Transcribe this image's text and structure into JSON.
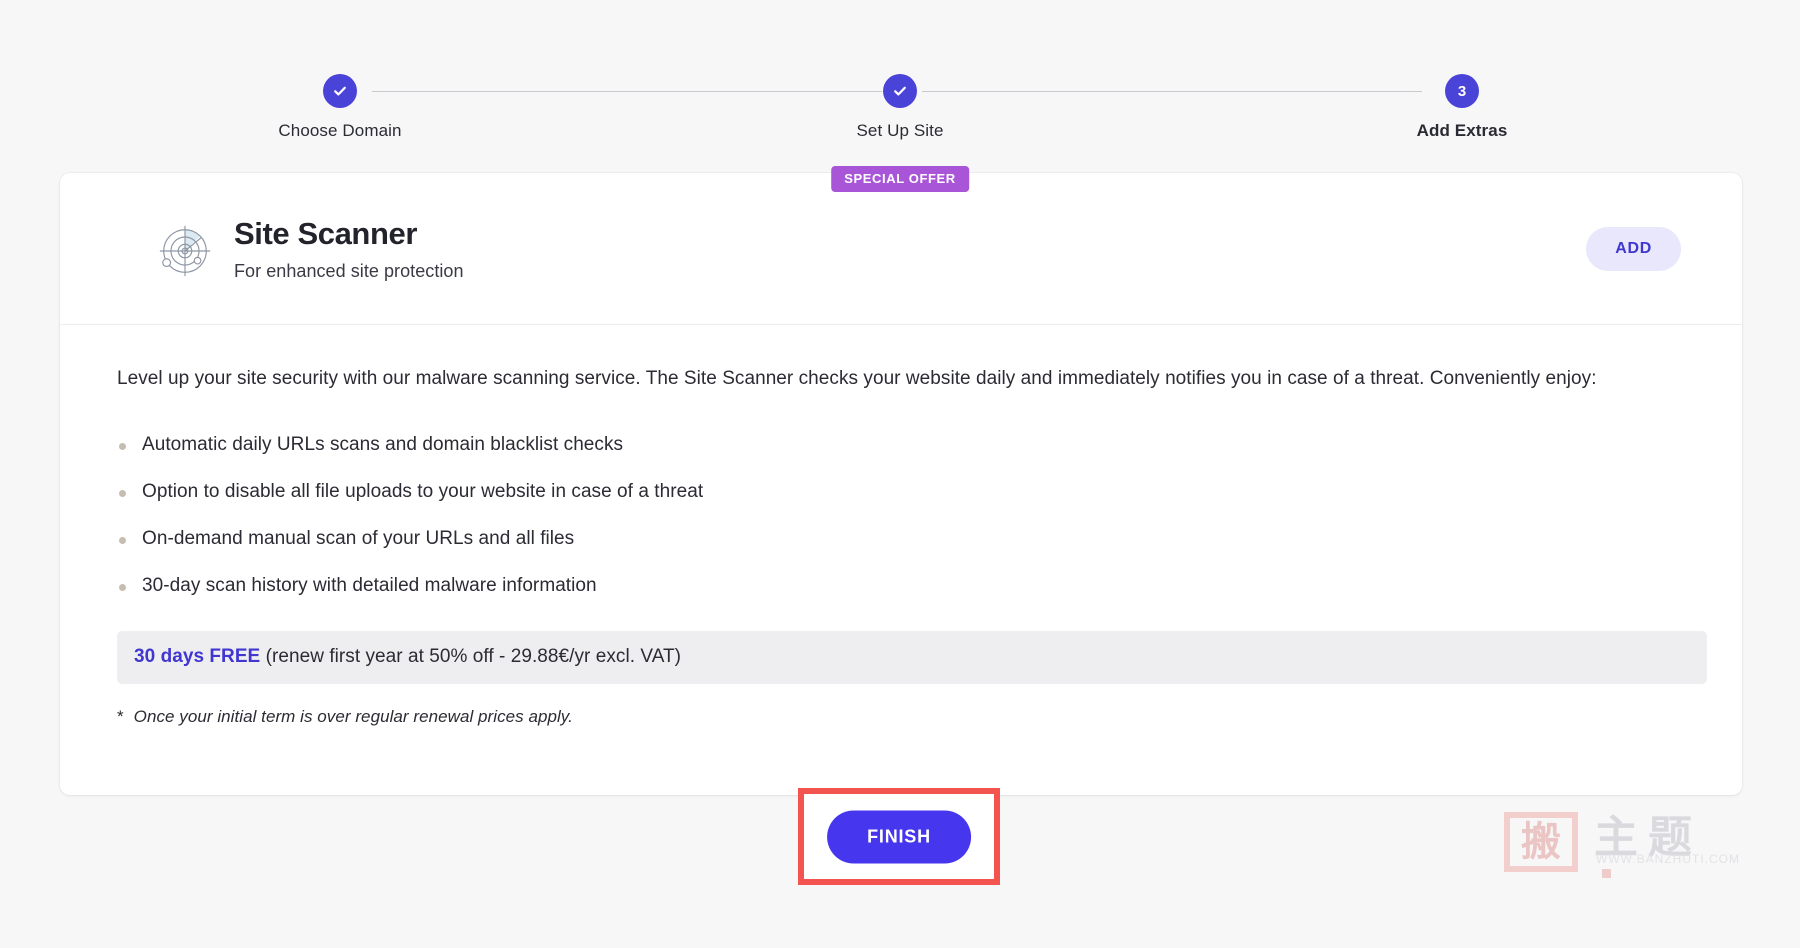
{
  "stepper": {
    "steps": [
      {
        "label": "Choose Domain",
        "state": "complete",
        "marker": "check"
      },
      {
        "label": "Set Up Site",
        "state": "complete",
        "marker": "check"
      },
      {
        "label": "Add Extras",
        "state": "current",
        "marker": "3"
      }
    ]
  },
  "offer": {
    "badge": "SPECIAL OFFER"
  },
  "card": {
    "icon": "radar-scanner-icon",
    "title": "Site Scanner",
    "subtitle": "For enhanced site protection",
    "add_label": "ADD",
    "paragraph": "Level up your site security with our malware scanning service. The Site Scanner checks your website daily and immediately notifies you in case of a threat. Conveniently enjoy:",
    "features": [
      "Automatic daily URLs scans and domain blacklist checks",
      "Option to disable all file uploads to your website in case of a threat",
      "On-demand manual scan of your URLs and all files",
      "30-day scan history with detailed malware information"
    ],
    "price": {
      "highlight": "30 days FREE",
      "rest": " (renew first year at 50% off - 29.88€/yr excl. VAT)"
    },
    "footnote": {
      "star": "*",
      "text": "Once your initial term is over regular renewal prices apply."
    }
  },
  "footer": {
    "finish_label": "FINISH"
  },
  "watermark": {
    "seal_char": "搬",
    "chars": "主题",
    "url": "WWW.BANZHUTI.COM"
  },
  "colors": {
    "accent": "#4943d8",
    "finish_button": "#4636ee",
    "add_button_bg": "#e8e7fb",
    "add_button_text": "#4036d0",
    "offer_badge": "#a855d8",
    "annotation_border": "#f4544f",
    "price_bar_bg": "#eeeef1",
    "bullet": "#c6bdb2",
    "page_bg": "#f7f7f8"
  }
}
